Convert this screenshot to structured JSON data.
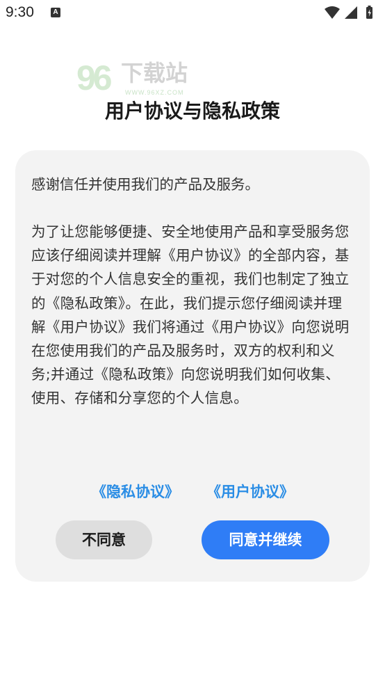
{
  "status_bar": {
    "time": "9:30",
    "notification_icon": "A",
    "icons": [
      "wifi-icon",
      "signal-icon",
      "battery-charging-icon"
    ]
  },
  "watermark": {
    "number": "96",
    "text": "下载站",
    "url": "WWW.96XZ.COM"
  },
  "dialog": {
    "title": "用户协议与隐私政策",
    "intro": "感谢信任并使用我们的产品及服务。",
    "body": "为了让您能够便捷、安全地使用产品和享受服务您应该仔细阅读并理解《用户协议》的全部内容，基于对您的个人信息安全的重视，我们也制定了独立的《隐私政策》。在此，我们提示您仔细阅读并理解《用户协议》我们将通过《用户协议》向您说明在您使用我们的产品及服务时，双方的权利和义务;并通过《隐私政策》向您说明我们如何收集、使用、存储和分享您的个人信息。",
    "links": {
      "privacy": "《隐私协议》",
      "user": "《用户协议》"
    },
    "buttons": {
      "disagree": "不同意",
      "agree": "同意并继续"
    }
  },
  "colors": {
    "accent": "#2f7df6",
    "link": "#2a8de5",
    "card_background": "#f3f3f3",
    "disagree_button": "#dedede"
  }
}
